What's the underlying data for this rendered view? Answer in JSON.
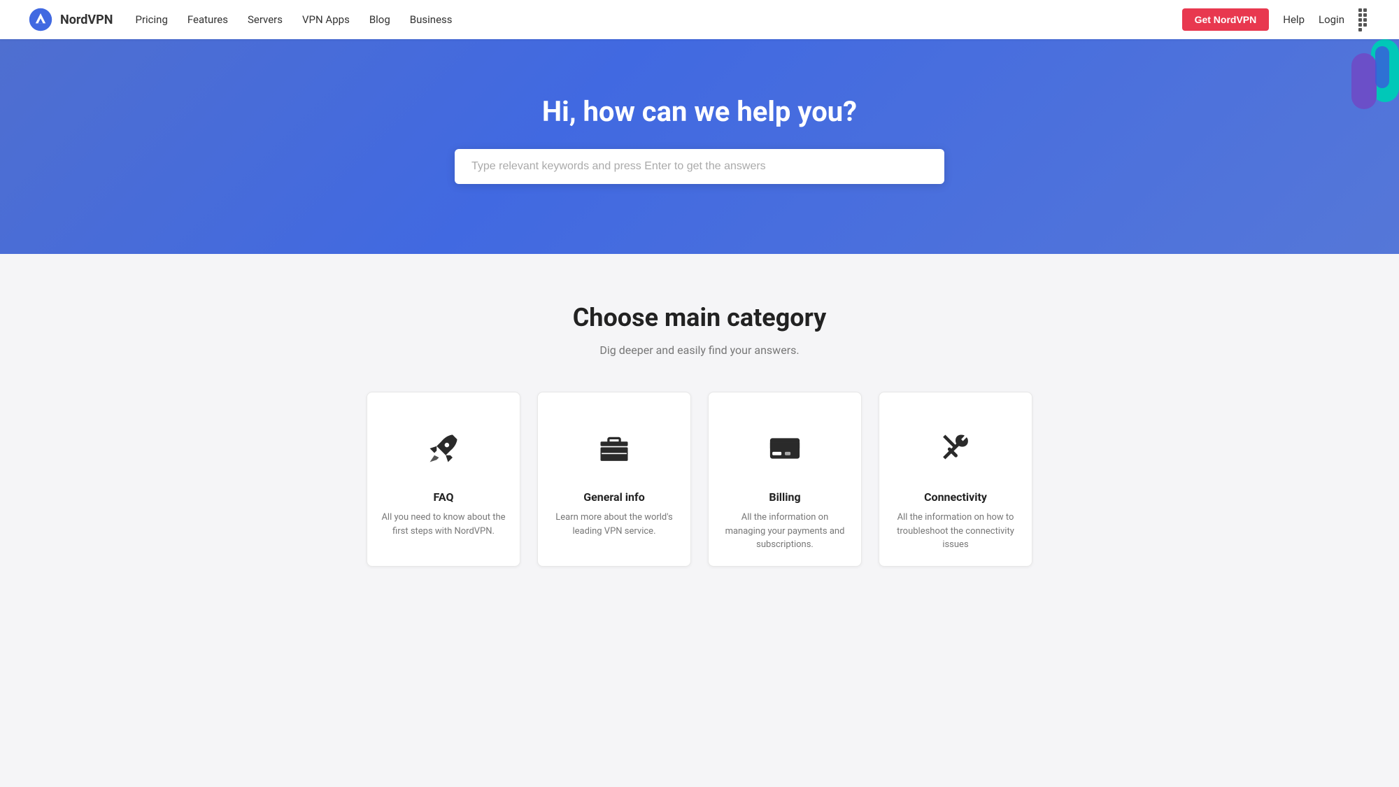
{
  "navbar": {
    "logo_text": "NordVPN",
    "nav_links": [
      {
        "label": "Pricing",
        "id": "pricing"
      },
      {
        "label": "Features",
        "id": "features"
      },
      {
        "label": "Servers",
        "id": "servers"
      },
      {
        "label": "VPN Apps",
        "id": "vpn-apps"
      },
      {
        "label": "Blog",
        "id": "blog"
      },
      {
        "label": "Business",
        "id": "business"
      }
    ],
    "cta_label": "Get NordVPN",
    "help_label": "Help",
    "login_label": "Login"
  },
  "hero": {
    "title": "Hi, how can we help you?",
    "search_placeholder": "Type relevant keywords and press Enter to get the answers"
  },
  "main": {
    "section_title": "Choose main category",
    "section_subtitle": "Dig deeper and easily find your answers.",
    "categories": [
      {
        "id": "faq",
        "name": "FAQ",
        "description": "All you need to know about the first steps with NordVPN."
      },
      {
        "id": "general-info",
        "name": "General info",
        "description": "Learn more about the world's leading VPN service."
      },
      {
        "id": "billing",
        "name": "Billing",
        "description": "All the information on managing your payments and subscriptions."
      },
      {
        "id": "connectivity",
        "name": "Connectivity",
        "description": "All the information on how to troubleshoot the connectivity issues"
      }
    ]
  }
}
